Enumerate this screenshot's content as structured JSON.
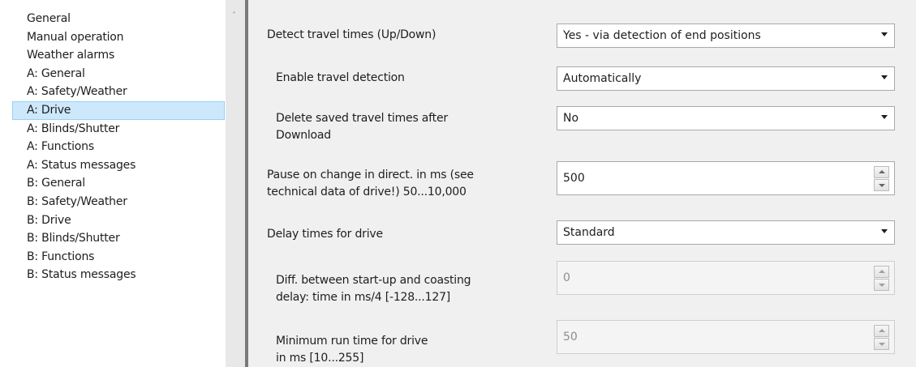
{
  "sidebar": {
    "items": [
      {
        "label": "General"
      },
      {
        "label": "Manual operation"
      },
      {
        "label": "Weather alarms"
      },
      {
        "label": "A: General"
      },
      {
        "label": "A: Safety/Weather"
      },
      {
        "label": "A: Drive",
        "selected": true
      },
      {
        "label": "A: Blinds/Shutter"
      },
      {
        "label": "A: Functions"
      },
      {
        "label": "A: Status messages"
      },
      {
        "label": "B: General"
      },
      {
        "label": "B: Safety/Weather"
      },
      {
        "label": "B: Drive"
      },
      {
        "label": "B: Blinds/Shutter"
      },
      {
        "label": "B: Functions"
      },
      {
        "label": "B: Status messages"
      }
    ]
  },
  "params": {
    "detect_travel": {
      "label": "Detect travel times (Up/Down)",
      "value": "Yes - via detection of end positions"
    },
    "enable_detection": {
      "label": "Enable travel detection",
      "value": "Automatically"
    },
    "delete_saved": {
      "label_line1": "Delete saved travel times after",
      "label_line2": "Download",
      "value": "No"
    },
    "pause_change": {
      "label_line1": "Pause on change in direct. in ms (see",
      "label_line2": "technical data of drive!)  50...10,000",
      "value": "500"
    },
    "delay_times": {
      "label": "Delay times for drive",
      "value": "Standard"
    },
    "diff_startup": {
      "label_line1": "Diff. between start-up and coasting",
      "label_line2": "delay: time in ms/4 [-128...127]",
      "value": "0"
    },
    "min_run": {
      "label_line1": "Minimum run time for drive",
      "label_line2": "in ms [10...255]",
      "value": "50"
    }
  },
  "colors": {
    "selection_bg": "#cde8fb",
    "selection_border": "#99d1f7",
    "panel_bg": "#f0f0f0"
  }
}
